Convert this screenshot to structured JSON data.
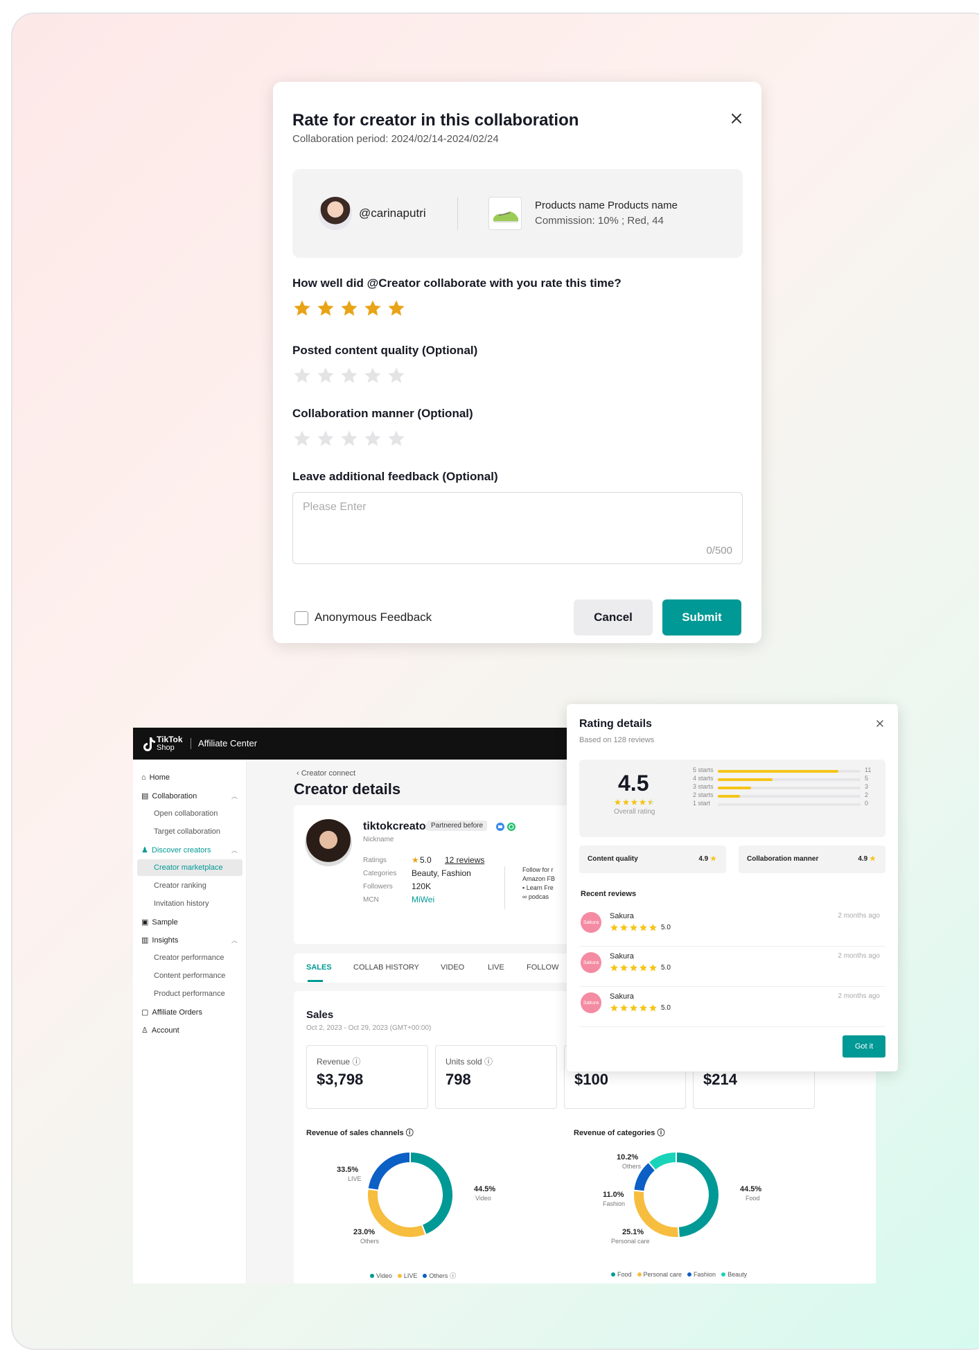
{
  "modal": {
    "title": "Rate for creator in this collaboration",
    "period": "Collaboration period: 2024/02/14-2024/02/24",
    "creator_handle": "@carinaputri",
    "product_name": "Products name Products name",
    "commission": "Commission: 10% ; Red, 44",
    "q_overall": "How well did @Creator collaborate with you rate this time?",
    "overall_rating": 5,
    "q_quality": "Posted content quality (Optional)",
    "quality_rating": 0,
    "q_manner": "Collaboration manner (Optional)",
    "manner_rating": 0,
    "q_feedback": "Leave additional feedback (Optional)",
    "feedback_placeholder": "Please Enter",
    "feedback_count": "0/500",
    "anonymous_label": "Anonymous Feedback",
    "cancel_label": "Cancel",
    "submit_label": "Submit",
    "colors": {
      "accent": "#009995",
      "star_on": "#e8a317",
      "star_off": "#e4e4e6"
    }
  },
  "app": {
    "logo_line1": "TikTok",
    "logo_line2": "Shop",
    "title": "Affiliate Center",
    "sidebar": {
      "home": "Home",
      "collaboration": "Collaboration",
      "open_collab": "Open collaboration",
      "target_collab": "Target collaboration",
      "discover": "Discover creators",
      "marketplace": "Creator marketplace",
      "ranking": "Creator ranking",
      "invitation": "Invitation history",
      "sample": "Sample",
      "insights": "Insights",
      "creator_perf": "Creator performance",
      "content_perf": "Content performance",
      "product_perf": "Product performance",
      "orders": "Affiliate Orders",
      "account": "Account"
    },
    "breadcrumb": "Creator connect",
    "page_title": "Creator details",
    "creator": {
      "name": "tiktokcreator",
      "badge": "Partnered before",
      "nickname": "Nickname",
      "ratings_label": "Ratings",
      "rating_value": "5.0",
      "reviews": "12 reviews",
      "categories_label": "Categories",
      "categories": "Beauty, Fashion",
      "followers_label": "Followers",
      "followers": "120K",
      "mcn_label": "MCN",
      "mcn": "MiWei",
      "bio_1": "Follow for r",
      "bio_2": "Amazon FB",
      "bio_3": "Learn Fre",
      "bio_4": "podcas"
    },
    "tabs": [
      "SALES",
      "COLLAB HISTORY",
      "VIDEO",
      "LIVE",
      "FOLLOW"
    ],
    "sales": {
      "title": "Sales",
      "date": "Oct 2, 2023 - Oct 29, 2023 (GMT+00:00)",
      "metrics": [
        {
          "label": "Revenue",
          "value": "$3,798"
        },
        {
          "label": "Units sold",
          "value": "798"
        },
        {
          "label": "",
          "value": "$100"
        },
        {
          "label": "",
          "value": "$214"
        }
      ]
    }
  },
  "chart_data": [
    {
      "type": "pie",
      "title": "Revenue of sales channels",
      "categories": [
        "Video",
        "LIVE",
        "Others"
      ],
      "values": [
        44.5,
        33.5,
        23.0
      ],
      "labels": [
        "44.5%",
        "33.5%",
        "23.0%"
      ],
      "colors": [
        "#009995",
        "#f7bd3f",
        "#0c5fc4"
      ]
    },
    {
      "type": "pie",
      "title": "Revenue of categories",
      "categories": [
        "Food",
        "Personal care",
        "Fashion",
        "Beauty"
      ],
      "legend": [
        "Food",
        "Personal care",
        "Fashion",
        "Beauty"
      ],
      "slice_names": [
        "Food",
        "Personal care",
        "Fashion",
        "Others"
      ],
      "values": [
        44.5,
        25.1,
        11.0,
        10.2
      ],
      "labels": [
        "44.5%",
        "25.1%",
        "11.0%",
        "10.2%"
      ],
      "colors": [
        "#009995",
        "#f7bd3f",
        "#0c5fc4",
        "#19d3b8"
      ]
    }
  ],
  "rating": {
    "title": "Rating details",
    "subtitle": "Based on 128 reviews",
    "overall": "4.5",
    "overall_label": "Overall rating",
    "bars": [
      {
        "label": "5 starts",
        "count": 11
      },
      {
        "label": "4 starts",
        "count": 5
      },
      {
        "label": "3 starts",
        "count": 3
      },
      {
        "label": "2 starts",
        "count": 2
      },
      {
        "label": "1 start",
        "count": 0
      }
    ],
    "content_quality_label": "Content quality",
    "content_quality": "4.9",
    "manner_label": "Collaboration manner",
    "manner": "4.9",
    "recent_label": "Recent reviews",
    "reviews": [
      {
        "avatar": "Sakura",
        "name": "Sakura",
        "score": "5.0",
        "time": "2 months ago"
      },
      {
        "avatar": "Sakura",
        "name": "Sakura",
        "score": "5.0",
        "time": "2 months ago"
      },
      {
        "avatar": "Sakura",
        "name": "Sakura",
        "score": "5.0",
        "time": "2 months ago"
      }
    ],
    "got_it": "Got it"
  }
}
